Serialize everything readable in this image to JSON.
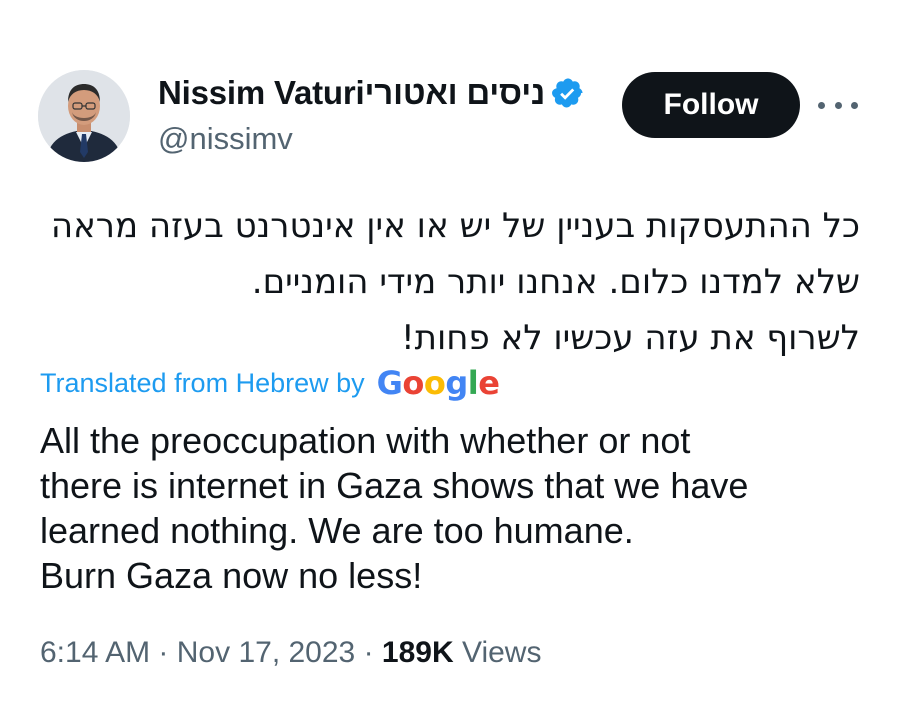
{
  "author": {
    "display_name": "Nissim Vaturiניסים ואטורי",
    "handle": "@nissimv",
    "verified": true,
    "verified_color": "#1d9bf0"
  },
  "actions": {
    "follow_label": "Follow"
  },
  "tweet": {
    "original_lines": [
      "כל ההתעסקות בעניין של יש או אין אינטרנט בעזה מראה",
      "שלא למדנו כלום. אנחנו יותר מידי הומניים.",
      "לשרוף את עזה עכשיו לא פחות!"
    ],
    "translated_label": "Translated from Hebrew by",
    "translator": "Google",
    "translation_lines": [
      "All the preoccupation with whether or not",
      "there is internet in Gaza shows that we have",
      "learned nothing. We are too humane.",
      "Burn Gaza now no less!"
    ]
  },
  "meta": {
    "time": "6:14 AM",
    "separator": "·",
    "date": "Nov 17, 2023",
    "views_count": "189K",
    "views_label": "Views"
  },
  "colors": {
    "text": "#0f1419",
    "secondary": "#536471",
    "link": "#1d9bf0",
    "button_bg": "#0f1419"
  },
  "icons": {
    "verified": "verified-badge-icon",
    "more": "more-options-icon",
    "google": "google-logo"
  }
}
